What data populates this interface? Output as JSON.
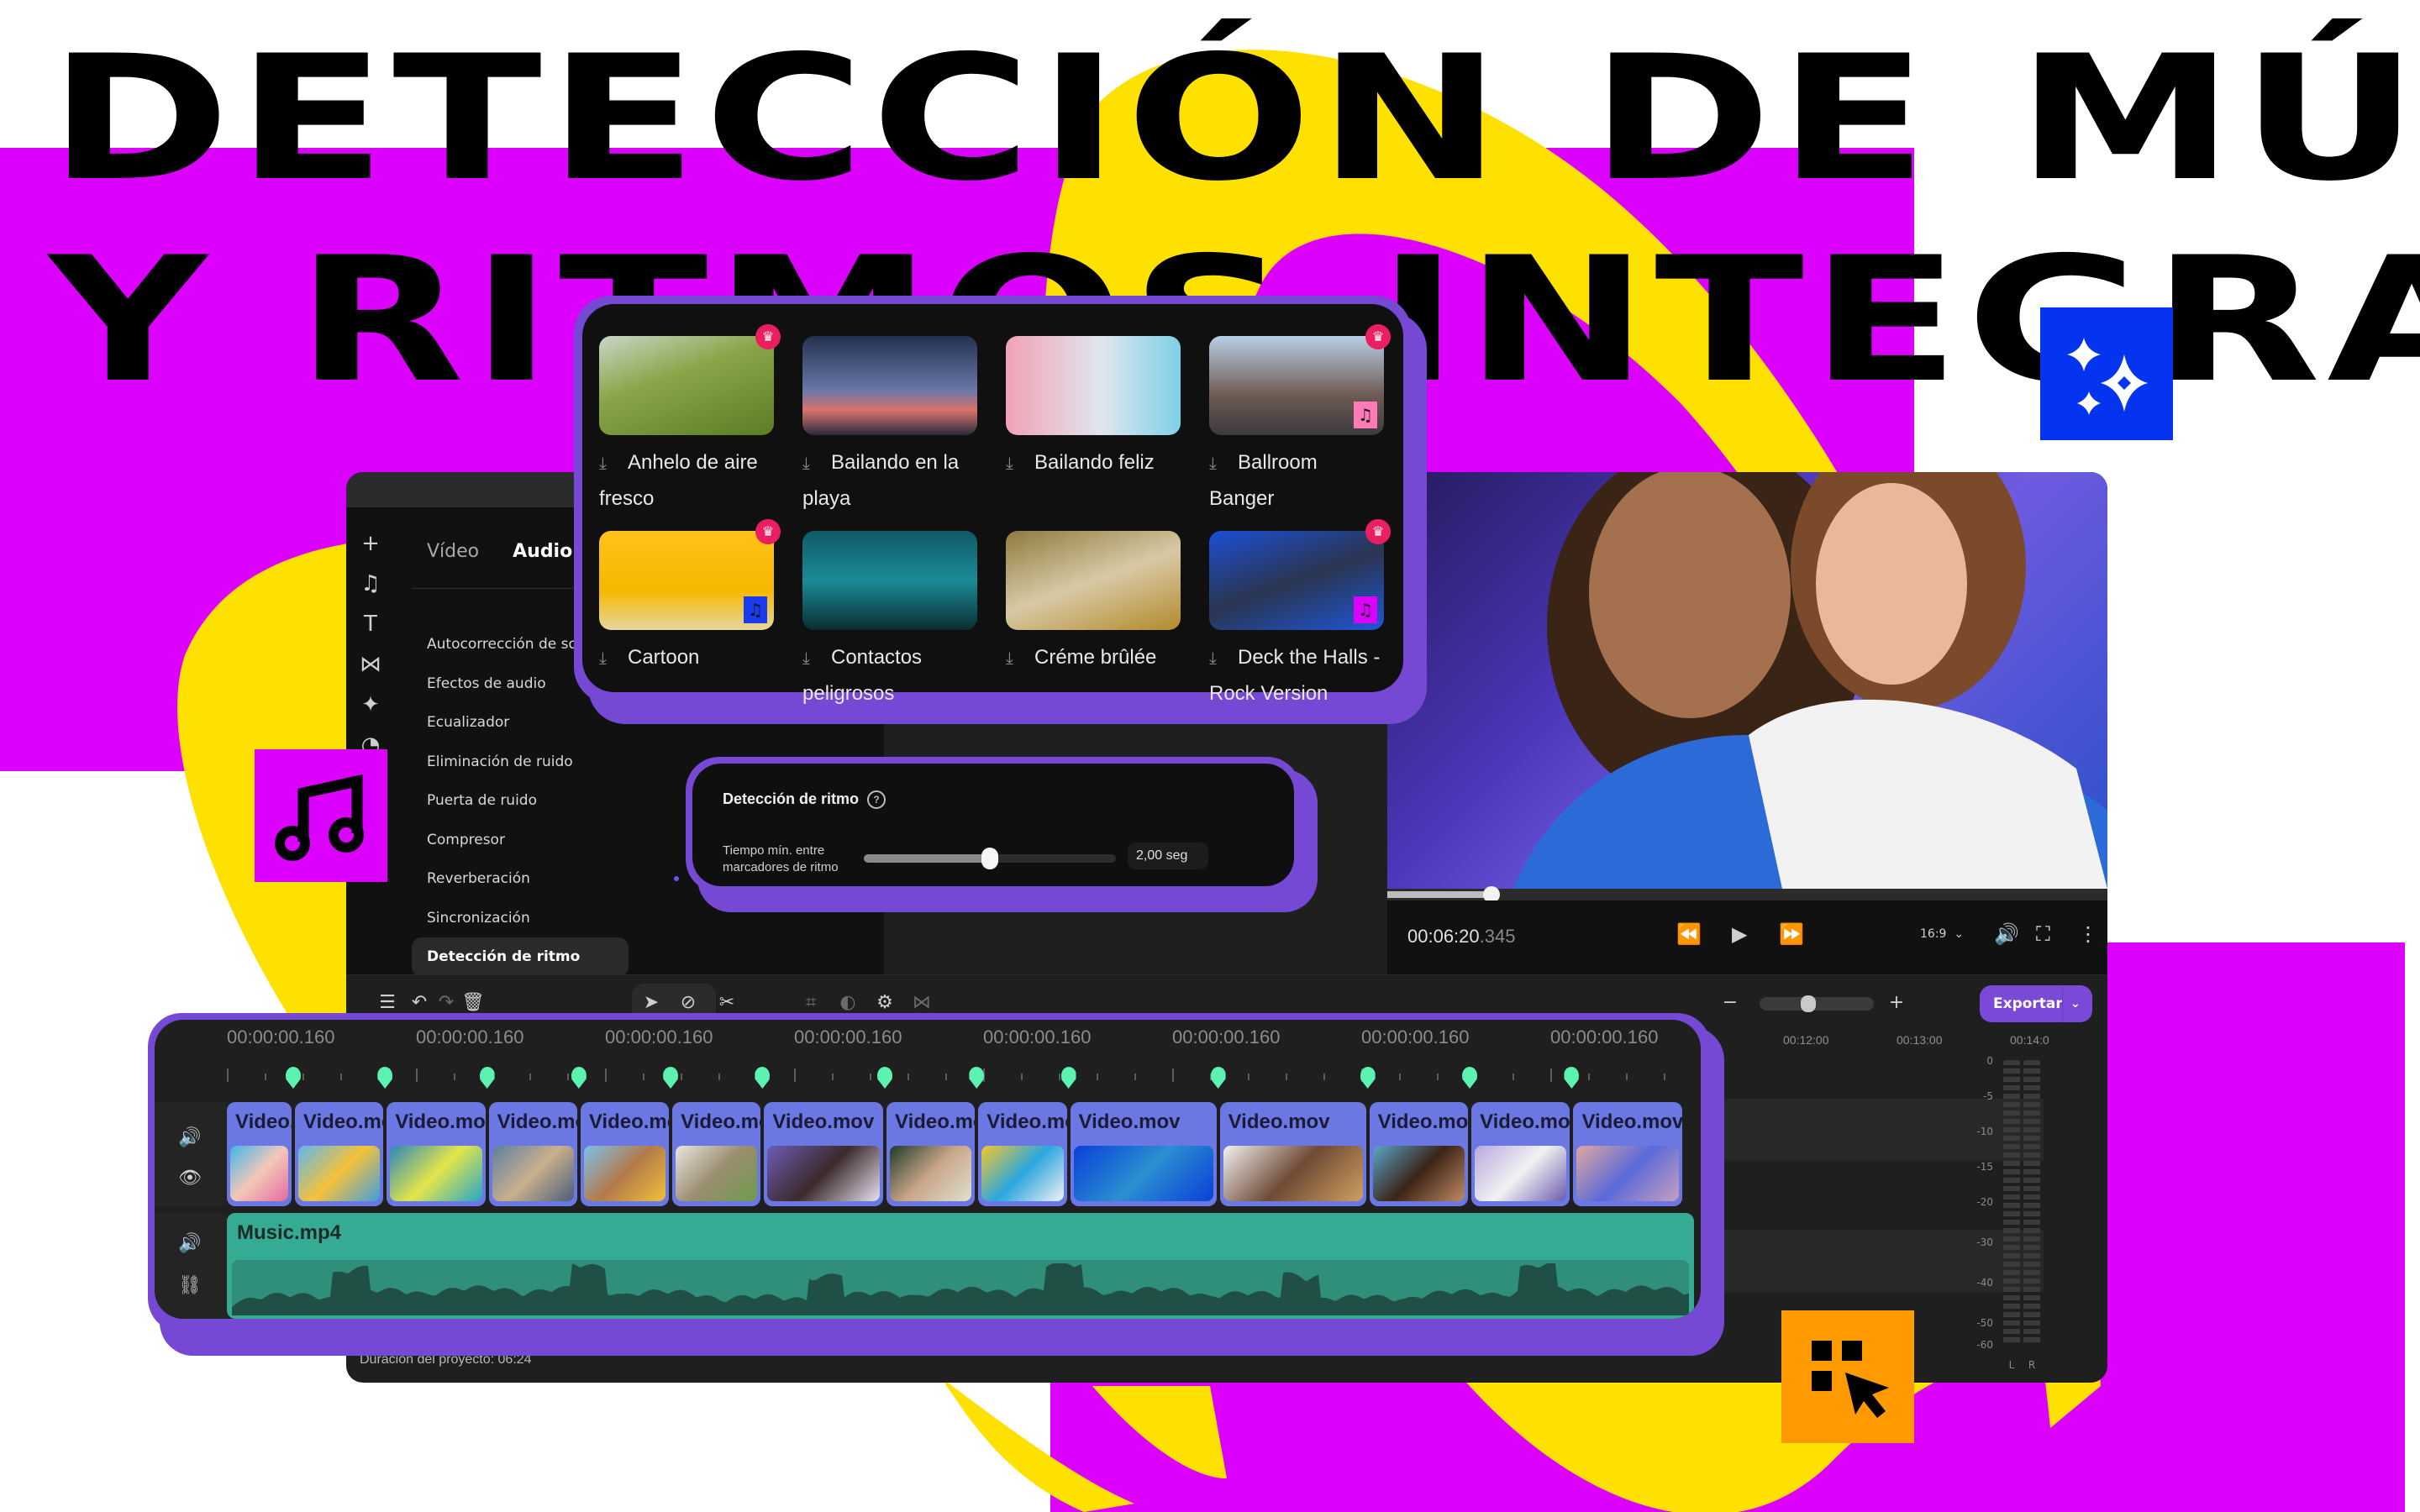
{
  "headline": {
    "line1": "DETECCIÓN DE MÚSICA",
    "line2": "Y RITMOS INTEGRADA"
  },
  "colors": {
    "magenta": "#dc00ff",
    "yellow": "#ffe100",
    "purple_frame": "#7549d4",
    "accent_blue": "#0534f0",
    "accent_orange": "#ff9a00",
    "clip_blue": "#6b78e3",
    "audio_teal": "#36ab94",
    "beat_marker": "#5cf2b0",
    "premium_crown": "#ec1e62",
    "export_purple": "#7b49d8"
  },
  "badges": {
    "top_right": "sparkles-icon",
    "left": "music-note-icon",
    "bottom": "cursor-select-icon"
  },
  "sidebar": {
    "rail": [
      {
        "icon": "add-icon",
        "glyph": "+"
      },
      {
        "icon": "music-icon",
        "glyph": "♫"
      },
      {
        "icon": "text-icon",
        "glyph": "T"
      },
      {
        "icon": "transitions-icon",
        "glyph": "⋈"
      },
      {
        "icon": "effects-icon",
        "glyph": "✦",
        "dot": true
      },
      {
        "icon": "stickers-icon",
        "glyph": "◔",
        "dot": true
      }
    ],
    "tabs": [
      {
        "label": "Vídeo",
        "active": false
      },
      {
        "label": "Audio",
        "active": true
      }
    ],
    "menu": [
      {
        "label": "Autocorrección de sonido"
      },
      {
        "label": "Efectos de audio"
      },
      {
        "label": "Ecualizador"
      },
      {
        "label": "Eliminación de ruido"
      },
      {
        "label": "Puerta de ruido"
      },
      {
        "label": "Compresor"
      },
      {
        "label": "Reverberación",
        "dot": true
      },
      {
        "label": "Sincronización"
      },
      {
        "label": "Detección de ritmo",
        "active": true
      }
    ]
  },
  "music_library": {
    "items": [
      {
        "title": "Anhelo de aire fresco",
        "premium": true,
        "badge": null,
        "thumb": "linear-gradient(160deg,#c9d6c7 0%,#8aa64a 40%,#5b7d24 100%)"
      },
      {
        "title": "Bailando en la playa",
        "premium": false,
        "badge": null,
        "thumb": "linear-gradient(180deg,#23314f 0%,#6a77a8 55%,#d8736a 75%,#2a2a3e 100%)"
      },
      {
        "title": "Bailando feliz",
        "premium": false,
        "badge": null,
        "thumb": "linear-gradient(90deg,#f2a2b4 0%,#dfe6ef 55%,#7fcfe6 100%)"
      },
      {
        "title": "Ballroom Banger",
        "premium": true,
        "badge": {
          "color": "#ff7ab6",
          "icon": "music-note-icon"
        },
        "thumb": "linear-gradient(180deg,#b9cfe6 0%,#6d5a52 60%,#3d3a3f 100%)"
      },
      {
        "title": "Cartoon",
        "premium": true,
        "badge": {
          "color": "#1a3cf0",
          "icon": "music-note-icon"
        },
        "thumb": "linear-gradient(180deg,#ffc21a 0%,#f5b800 60%,#e8d6a0 100%)"
      },
      {
        "title": "Contactos peligrosos",
        "premium": false,
        "badge": null,
        "thumb": "linear-gradient(180deg,#0f5a66 0%,#1a8b96 50%,#0a2d33 100%)"
      },
      {
        "title": "Créme brûlée",
        "premium": false,
        "badge": null,
        "thumb": "linear-gradient(160deg,#8f7b3e 0%,#d8c9a6 50%,#b38a2c 100%)"
      },
      {
        "title": "Deck the Halls - Rock Version",
        "premium": true,
        "badge": {
          "color": "#dc00ff",
          "icon": "music-note-icon"
        },
        "thumb": "linear-gradient(160deg,#1c4fd6 0%,#2a3550 50%,#1e56d9 100%)"
      }
    ],
    "download_glyph": "⤓"
  },
  "beat_detection": {
    "title": "Detección de ritmo",
    "help_glyph": "?",
    "label": "Tiempo mín. entre marcadores de ritmo",
    "value": "2,00 seg",
    "slider_fraction": 0.5
  },
  "player": {
    "time_main": "00:06:20",
    "time_ms": ".345",
    "progress_fraction": 0.145,
    "aspect_ratio": "16:9",
    "controls": {
      "rewind": "⏪",
      "play": "▶",
      "forward": "⏩",
      "volume": "🔊",
      "fullscreen": "⛶",
      "more": "⋮"
    }
  },
  "toolbar": {
    "add_track": "☰",
    "undo": "↶",
    "redo": "↷",
    "delete": "🗑",
    "select": "➤",
    "magnet": "⊘",
    "cut": "✂",
    "crop": "⌗",
    "color": "◐",
    "adjust": "⚙",
    "transition": "⋈",
    "zoom_minus": "−",
    "zoom_plus": "+",
    "zoom_fraction": 0.42,
    "export_label": "Exportar",
    "export_chevron": "⌄"
  },
  "timeline": {
    "ruler_labels": [
      "00:00:00.160",
      "00:00:00.160",
      "00:00:00.160",
      "00:00:00.160",
      "00:00:00.160",
      "00:00:00.160",
      "00:00:00.160",
      "00:00:00.160"
    ],
    "ruler_right_labels": [
      "00:12:00",
      "00:13:00",
      "00:14:0"
    ],
    "video_clips": [
      {
        "label": "Video.mov",
        "width_units": 1.0,
        "thumb": "linear-gradient(135deg,#3fb6e8,#f3c8b8,#e46aa0)"
      },
      {
        "label": "Video.mov",
        "width_units": 1.35,
        "thumb": "linear-gradient(135deg,#5fb7ee,#f5c23a,#3f9fe0)"
      },
      {
        "label": "Video.mov",
        "width_units": 1.5,
        "thumb": "linear-gradient(135deg,#2a88b8,#e5e64a,#24a6c9)"
      },
      {
        "label": "Video.mov",
        "width_units": 1.35,
        "thumb": "linear-gradient(135deg,#5e7fa0,#c9b08c,#4b5d7b)"
      },
      {
        "label": "Video.mov",
        "width_units": 1.35,
        "thumb": "linear-gradient(135deg,#7cc0ec,#b27b4a,#f0c03a)"
      },
      {
        "label": "Video.mov",
        "width_units": 1.35,
        "thumb": "linear-gradient(135deg,#e8e6e0,#9b8d6f,#6d9b4c)"
      },
      {
        "label": "Video.mov",
        "width_units": 1.8,
        "thumb": "linear-gradient(135deg,#6e5bb8,#3b2a2a,#e8e2f0)"
      },
      {
        "label": "Video.mov",
        "width_units": 1.35,
        "thumb": "linear-gradient(135deg,#1f3a2a,#c9a68a,#e0e0d0)"
      },
      {
        "label": "Video.mov",
        "width_units": 1.35,
        "thumb": "linear-gradient(135deg,#f5c829,#2aa6e0,#f2f2f2)"
      },
      {
        "label": "Video.mov",
        "width_units": 2.2,
        "thumb": "linear-gradient(135deg,#0a3fd8,#2a8fd0,#0a3fd8)"
      },
      {
        "label": "Video.mov",
        "width_units": 2.2,
        "thumb": "linear-gradient(135deg,#f2f2f2,#6e4a35,#d0a060)"
      },
      {
        "label": "Video.mov",
        "width_units": 1.5,
        "thumb": "linear-gradient(135deg,#5aa6c8,#3b2418,#c08a60)"
      },
      {
        "label": "Video.mov",
        "width_units": 1.5,
        "thumb": "linear-gradient(135deg,#b8a8e0,#f2f2f2,#6a5ab0)"
      },
      {
        "label": "Video.mov",
        "width_units": 1.65,
        "thumb": "linear-gradient(135deg,#e0a8a0,#5a6ad8,#c8a0c0)"
      }
    ],
    "audio_clip": {
      "label": "Music.mp4"
    },
    "track_icons": {
      "video_audio": "🔊",
      "video_visibility": "👁",
      "audio_volume": "🔊",
      "audio_unlink": "⛓"
    },
    "meter_labels": [
      "0",
      "-5",
      "-10",
      "-15",
      "-20",
      "-30",
      "-40",
      "-50",
      "-60"
    ],
    "meter_channels": [
      "L",
      "R"
    ],
    "project_duration": "Duración del proyecto: 06:24"
  }
}
